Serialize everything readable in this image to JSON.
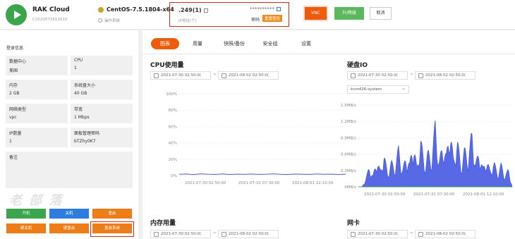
{
  "header": {
    "brand": "RAK Cloud",
    "instance_id": "C2020071611610",
    "os_name": "CentOS-7.5.1804-x64",
    "os_action": "操作系统",
    "ip_value": ".249(1)",
    "ip_label": "IP地址(个)",
    "password_mask": "**********",
    "password_label": "密码",
    "reset_password": "重置密码",
    "vnc": "VNC",
    "upgrade": "升/降级",
    "cancel": "取消"
  },
  "sidebar": {
    "title": "登录信息",
    "fields": [
      {
        "label": "数据中心",
        "value": "美国"
      },
      {
        "label": "CPU",
        "value": "1"
      },
      {
        "label": "内存",
        "value": "2 GB"
      },
      {
        "label": "系统盘大小",
        "value": "40 GB"
      },
      {
        "label": "网络类型",
        "value": "vpc"
      },
      {
        "label": "带宽",
        "value": "1 Mbps"
      },
      {
        "label": "IP数量",
        "value": "1"
      },
      {
        "label": "面板管理密码",
        "value": "bTZhy0K7"
      },
      {
        "label": "备注",
        "value": ""
      }
    ],
    "watermark": "老 部 落",
    "actions": [
      "开机",
      "关机",
      "重启",
      "硬关机",
      "硬重启",
      "重装系统"
    ]
  },
  "tabs": [
    "图表",
    "用量",
    "快照/备份",
    "安全组",
    "设置"
  ],
  "sections": {
    "cpu": "CPU使用量",
    "disk": "硬盘IO",
    "mem": "内存用量",
    "net": "网卡"
  },
  "dates": {
    "start": "2021-07-30 02:50:0(",
    "end": "2021-08-02 02:50:0(",
    "sep": "~"
  },
  "disk_select": "kvm426-system",
  "chart_data": [
    {
      "type": "line",
      "title": "CPU使用量",
      "x_ticks": [
        "2021-07-30 02:50:00",
        "2021-07-31 07:30:00",
        "2021-08-01 12:10:00"
      ],
      "y_ticks": [
        "0%",
        "20%",
        "40%",
        "60%",
        "80%",
        "100%"
      ],
      "ylim": [
        0,
        100
      ],
      "series": [
        {
          "values": [
            1.5,
            1.8,
            1.2,
            2,
            1.6,
            1.4,
            1.9,
            1.3,
            1.7,
            1.5,
            1.8,
            1.4,
            1.6,
            2,
            1.5,
            1.3,
            1.8,
            1.6,
            1.4,
            1.9,
            1.5,
            1.7,
            1.3,
            1.6
          ]
        }
      ],
      "color": "#4a5bd4"
    },
    {
      "type": "area",
      "title": "硬盘IO",
      "x_ticks": [
        "2021-07-30 02:50:00",
        "2021-07-31 07:30:00",
        "2021-08-01 12:10:00"
      ],
      "y_ticks": [
        "0MB/s",
        "0.3MB/s",
        "0.6MB/s",
        "0.9MB/s",
        "1.2MB/s",
        "1.5MB/s"
      ],
      "ylim": [
        0,
        1.5
      ],
      "series": [
        {
          "values": [
            0,
            0,
            0.15,
            0.4,
            0.2,
            0.55,
            0.3,
            0.65,
            0.25,
            0.5,
            0.35,
            0.8,
            0.3,
            0.6,
            0.45,
            0.9,
            0.35,
            1.0,
            0.4,
            0.7,
            0.5,
            1.3,
            0.45,
            0.85,
            0.6,
            1.2,
            0.5,
            0.95,
            0.4,
            0.75,
            0.55,
            1.1,
            0.45,
            0.7,
            0.35,
            0.55,
            0.3,
            0.5,
            0.25,
            0.45,
            0.2,
            0.35,
            0
          ]
        }
      ],
      "color": "#3b4fe0"
    }
  ]
}
